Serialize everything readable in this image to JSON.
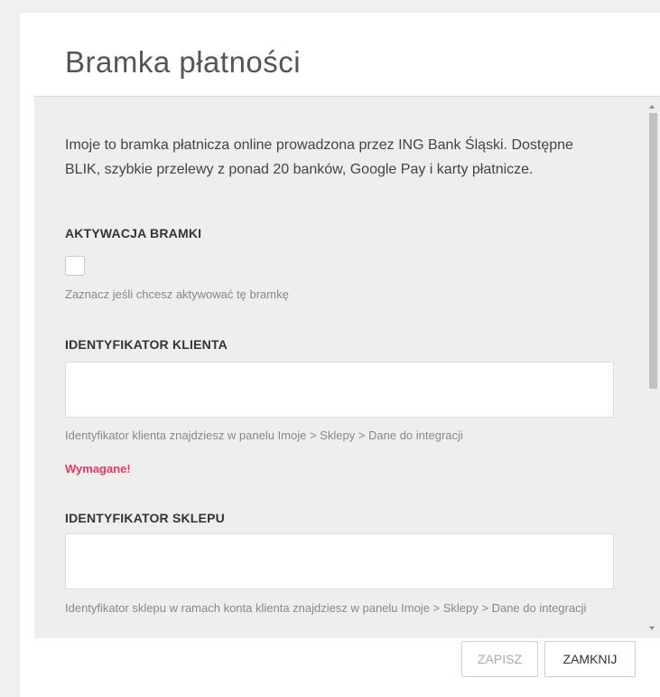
{
  "dialog": {
    "title": "Bramka płatności",
    "description": "Imoje to bramka płatnicza online prowadzona przez ING Bank Śląski. Dostępne BLIK, szybkie przelewy z ponad 20 banków, Google Pay i karty płatnicze.",
    "activation": {
      "label": "AKTYWACJA BRAMKI",
      "checked": false,
      "help": "Zaznacz jeśli chcesz aktywować tę bramkę"
    },
    "client_id": {
      "label": "IDENTYFIKATOR KLIENTA",
      "value": "",
      "help": "Identyfikator klienta znajdziesz w panelu Imoje > Sklepy > Dane do integracji",
      "error": "Wymagane!"
    },
    "shop_id": {
      "label": "IDENTYFIKATOR SKLEPU",
      "value": "",
      "help": "Identyfikator sklepu w ramach konta klienta znajdziesz w panelu Imoje > Sklepy > Dane do integracji"
    },
    "buttons": {
      "save": "ZAPISZ",
      "close": "ZAMKNIJ"
    },
    "scroll_position": 0
  }
}
